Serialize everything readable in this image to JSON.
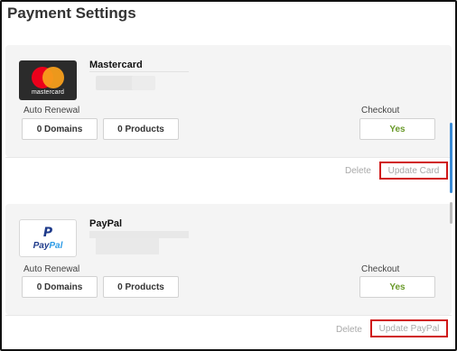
{
  "page": {
    "title": "Payment Settings"
  },
  "cards": [
    {
      "name": "Mastercard",
      "logo_text": "mastercard",
      "auto_renewal_label": "Auto Renewal",
      "domains": "0 Domains",
      "products": "0 Products",
      "checkout_label": "Checkout",
      "checkout_value": "Yes",
      "delete_label": "Delete",
      "update_label": "Update Card"
    },
    {
      "name": "PayPal",
      "logo_glyph": "P",
      "logo_text_a": "Pay",
      "logo_text_b": "Pal",
      "auto_renewal_label": "Auto Renewal",
      "domains": "0 Domains",
      "products": "0 Products",
      "checkout_label": "Checkout",
      "checkout_value": "Yes",
      "delete_label": "Delete",
      "update_label": "Update PayPal"
    }
  ],
  "colors": {
    "highlight_border": "#d01818",
    "yes_green": "#6a9a2a",
    "scrollbar": "#3b8bd6"
  }
}
